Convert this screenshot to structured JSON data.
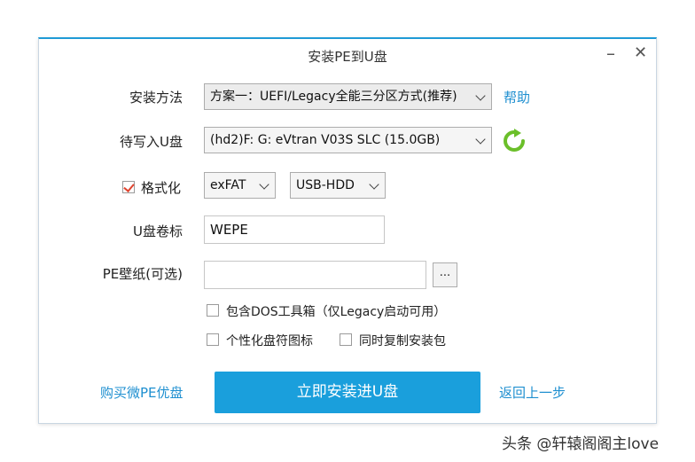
{
  "window": {
    "title": "安装PE到U盘",
    "minimize": "–",
    "close": "✕"
  },
  "form": {
    "method_label": "安装方法",
    "method_value": "方案一：UEFI/Legacy全能三分区方式(推荐)",
    "help_link": "帮助",
    "drive_label": "待写入U盘",
    "drive_value": "(hd2)F: G: eVtran V03S SLC (15.0GB)",
    "format_label": "格式化",
    "format_checked": true,
    "fs_value": "exFAT",
    "mode_value": "USB-HDD",
    "volume_label": "U盘卷标",
    "volume_value": "WEPE",
    "wallpaper_label": "PE壁纸(可选)",
    "wallpaper_value": "",
    "browse_label": "...",
    "dos_label": "包含DOS工具箱（仅Legacy启动可用）",
    "icon_label": "个性化盘符图标",
    "copy_label": "同时复制安装包"
  },
  "footer": {
    "buy_link": "购买微PE优盘",
    "install_button": "立即安装进U盘",
    "back_link": "返回上一步"
  },
  "watermark": "头条 @轩辕阁阁主love",
  "colors": {
    "accent": "#1a9fdc",
    "link": "#1e8fd0",
    "refresh": "#6bbf2a",
    "check": "#e0442f"
  }
}
